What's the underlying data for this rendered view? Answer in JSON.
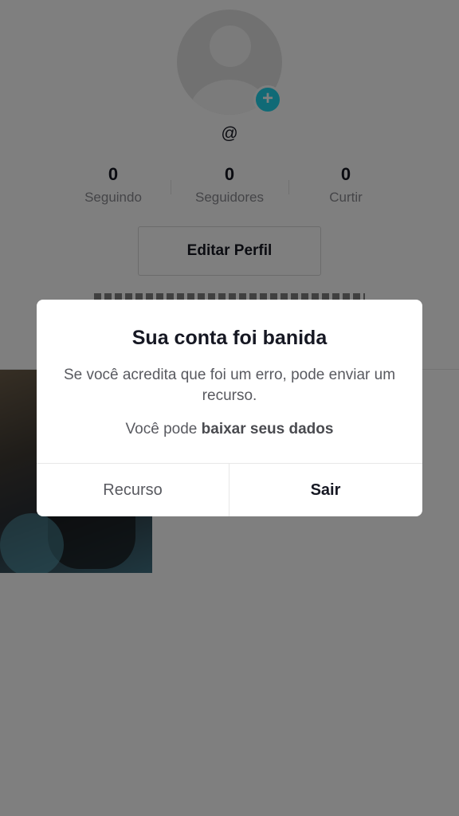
{
  "profile": {
    "handle": "@",
    "stats": [
      {
        "value": "0",
        "label": "Seguindo"
      },
      {
        "value": "0",
        "label": "Seguidores"
      },
      {
        "value": "0",
        "label": "Curtir"
      }
    ],
    "edit_label": "Editar Perfil",
    "accent_color": "#20d5ec"
  },
  "dialog": {
    "title": "Sua conta foi banida",
    "message": "Se você acredita que foi um erro, pode enviar um recurso.",
    "data_prefix": "Você pode ",
    "data_link": "baixar seus dados",
    "appeal_label": "Recurso",
    "exit_label": "Sair"
  },
  "icons": {
    "avatar": "default-user-avatar",
    "add": "plus-icon"
  }
}
